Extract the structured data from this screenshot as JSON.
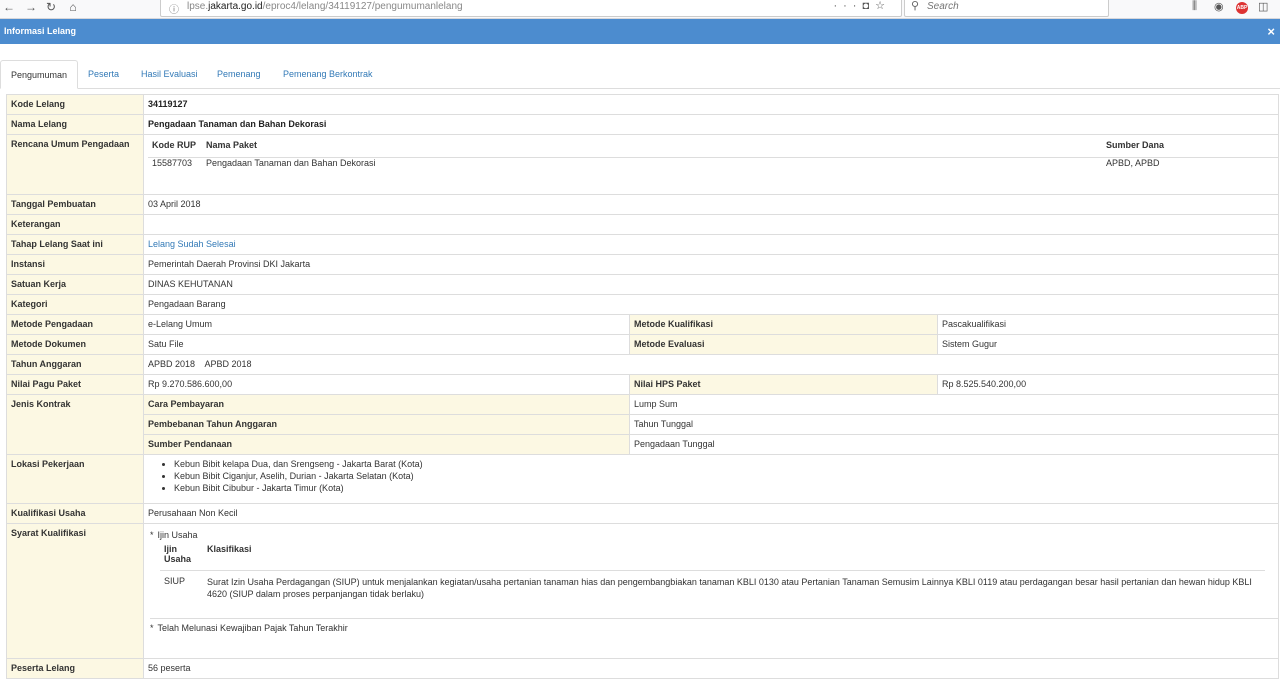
{
  "browser": {
    "url_host": "lpse.jakarta.go.id",
    "url_path": "/eproc4/lelang/34119127/pengumumanlelang",
    "url_prefix": "lpse.",
    "url_domain": "jakarta.go.id",
    "search_placeholder": "Search",
    "abp_label": "ABP"
  },
  "dialog": {
    "title": "Informasi Lelang",
    "close": "×"
  },
  "tabs": [
    {
      "label": "Pengumuman",
      "active": true
    },
    {
      "label": "Peserta"
    },
    {
      "label": "Hasil Evaluasi"
    },
    {
      "label": "Pemenang"
    },
    {
      "label": "Pemenang Berkontrak"
    }
  ],
  "info": {
    "kode_lelang": {
      "label": "Kode Lelang",
      "value": "34119127"
    },
    "nama_lelang": {
      "label": "Nama Lelang",
      "value": "Pengadaan Tanaman dan Bahan Dekorasi"
    },
    "rup": {
      "label": "Rencana Umum Pengadaan",
      "headers": [
        "Kode RUP",
        "Nama Paket",
        "Sumber Dana"
      ],
      "rows": [
        [
          "15587703",
          "Pengadaan Tanaman dan Bahan Dekorasi",
          "APBD, APBD"
        ]
      ]
    },
    "tanggal_pembuatan": {
      "label": "Tanggal Pembuatan",
      "value": "03 April 2018"
    },
    "keterangan": {
      "label": "Keterangan",
      "value": ""
    },
    "tahap": {
      "label": "Tahap Lelang Saat ini",
      "value": "Lelang Sudah Selesai"
    },
    "instansi": {
      "label": "Instansi",
      "value": "Pemerintah Daerah Provinsi DKI Jakarta"
    },
    "satuan_kerja": {
      "label": "Satuan Kerja",
      "value": "DINAS KEHUTANAN"
    },
    "kategori": {
      "label": "Kategori",
      "value": "Pengadaan Barang"
    },
    "metode_pengadaan": {
      "label": "Metode Pengadaan",
      "value": "e-Lelang Umum"
    },
    "metode_kualifikasi": {
      "label": "Metode Kualifikasi",
      "value": "Pascakualifikasi"
    },
    "metode_dokumen": {
      "label": "Metode Dokumen",
      "value": "Satu File"
    },
    "metode_evaluasi": {
      "label": "Metode Evaluasi",
      "value": "Sistem Gugur"
    },
    "tahun_anggaran": {
      "label": "Tahun Anggaran",
      "value": "APBD 2018    APBD 2018"
    },
    "nilai_pagu": {
      "label": "Nilai Pagu Paket",
      "value": "Rp 9.270.586.600,00"
    },
    "nilai_hps": {
      "label": "Nilai HPS Paket",
      "value": "Rp 8.525.540.200,00"
    },
    "jenis_kontrak": {
      "label": "Jenis Kontrak",
      "cara_pembayaran": {
        "label": "Cara Pembayaran",
        "value": "Lump Sum"
      },
      "pembebanan": {
        "label": "Pembebanan Tahun Anggaran",
        "value": "Tahun Tunggal"
      },
      "sumber_pendanaan": {
        "label": "Sumber Pendanaan",
        "value": "Pengadaan Tunggal"
      }
    },
    "lokasi": {
      "label": "Lokasi Pekerjaan",
      "items": [
        "Kebun Bibit kelapa Dua, dan Srengseng - Jakarta Barat (Kota)",
        "Kebun Bibit Ciganjur, Aselih, Durian - Jakarta Selatan (Kota)",
        "Kebun Bibit Cibubur - Jakarta Timur (Kota)"
      ]
    },
    "kualifikasi_usaha": {
      "label": "Kualifikasi Usaha",
      "value": "Perusahaan Non Kecil"
    },
    "syarat": {
      "label": "Syarat Kualifikasi",
      "bullet": "*",
      "ijin_title": "Ijin Usaha",
      "headers": [
        "Ijin Usaha",
        "Klasifikasi"
      ],
      "rows": [
        [
          "SIUP",
          "Surat Izin Usaha Perdagangan (SIUP) untuk menjalankan kegiatan/usaha pertanian tanaman hias dan pengembangbiakan tanaman KBLI 0130 atau Pertanian Tanaman Semusim Lainnya KBLI 0119 atau perdagangan besar hasil pertanian dan hewan hidup KBLI 4620 (SIUP dalam proses perpanjangan tidak berlaku)"
        ]
      ],
      "pajak": "Telah Melunasi Kewajiban Pajak Tahun Terakhir"
    },
    "peserta": {
      "label": "Peserta Lelang",
      "value": "56 peserta"
    }
  }
}
